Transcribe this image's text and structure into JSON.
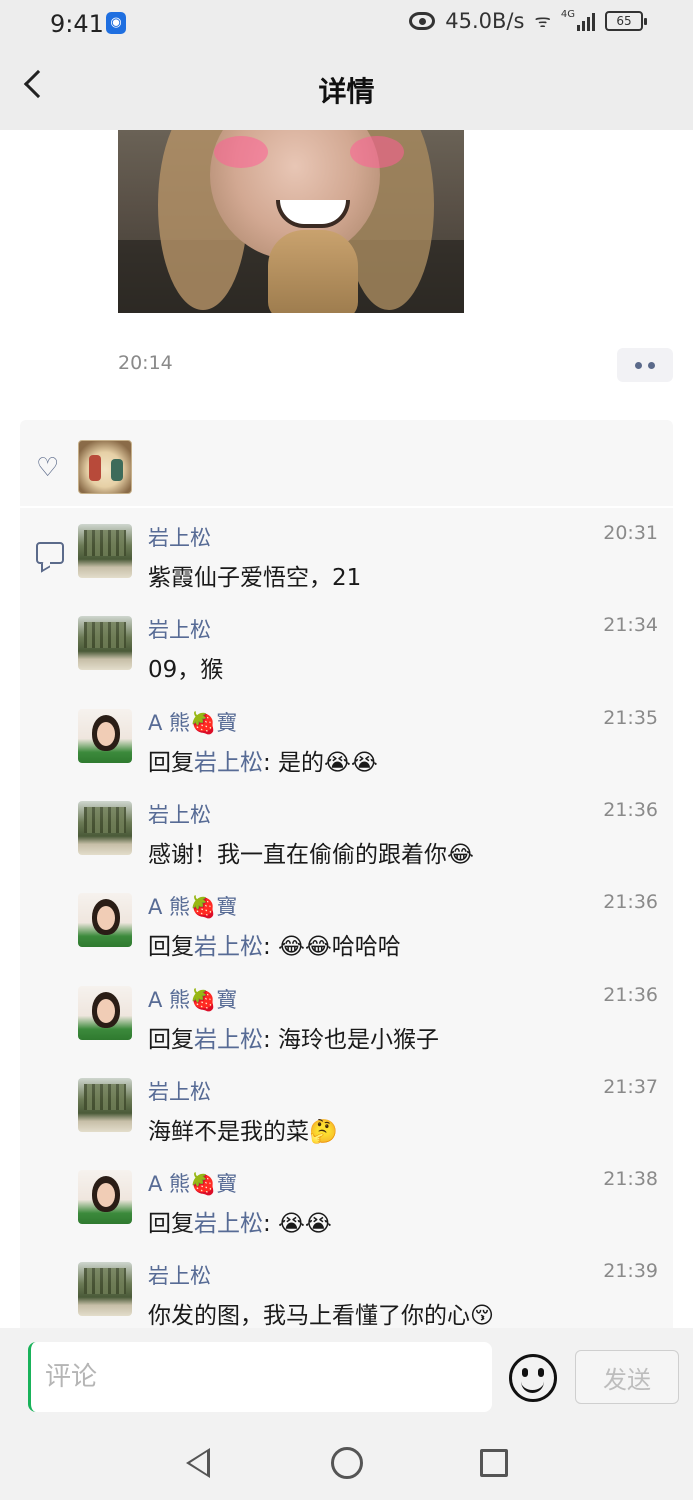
{
  "status_bar": {
    "time": "9:41",
    "network_speed": "45.0B/s",
    "network_type": "4G",
    "battery": "65"
  },
  "header": {
    "title": "详情"
  },
  "post": {
    "time": "20:14"
  },
  "comments": [
    {
      "name": "岩上松",
      "time": "20:31",
      "reply_to": "",
      "text": "紫霞仙子爱悟空，21",
      "avatar": "forest"
    },
    {
      "name": "岩上松",
      "time": "21:34",
      "reply_to": "",
      "text": "09，猴",
      "avatar": "forest"
    },
    {
      "name": "A  熊🍓寶",
      "time": "21:35",
      "reply_to": "岩上松",
      "text": ": 是的😭😭",
      "avatar": "girl"
    },
    {
      "name": "岩上松",
      "time": "21:36",
      "reply_to": "",
      "text": "感谢！我一直在偷偷的跟着你😂",
      "avatar": "forest"
    },
    {
      "name": "A  熊🍓寶",
      "time": "21:36",
      "reply_to": "岩上松",
      "text": ": 😂😂哈哈哈",
      "avatar": "girl"
    },
    {
      "name": "A  熊🍓寶",
      "time": "21:36",
      "reply_to": "岩上松",
      "text": ": 海玲也是小猴子",
      "avatar": "girl"
    },
    {
      "name": "岩上松",
      "time": "21:37",
      "reply_to": "",
      "text": "海鲜不是我的菜🤔",
      "avatar": "forest"
    },
    {
      "name": "A  熊🍓寶",
      "time": "21:38",
      "reply_to": "岩上松",
      "text": ": 😭😭",
      "avatar": "girl"
    },
    {
      "name": "岩上松",
      "time": "21:39",
      "reply_to": "",
      "text": "你发的图，我马上看懂了你的心😚",
      "avatar": "forest"
    }
  ],
  "reply_prefix": "回复",
  "input": {
    "placeholder": "评论",
    "send_label": "发送"
  },
  "colors": {
    "link": "#576b95",
    "cursor": "#19b25a"
  }
}
